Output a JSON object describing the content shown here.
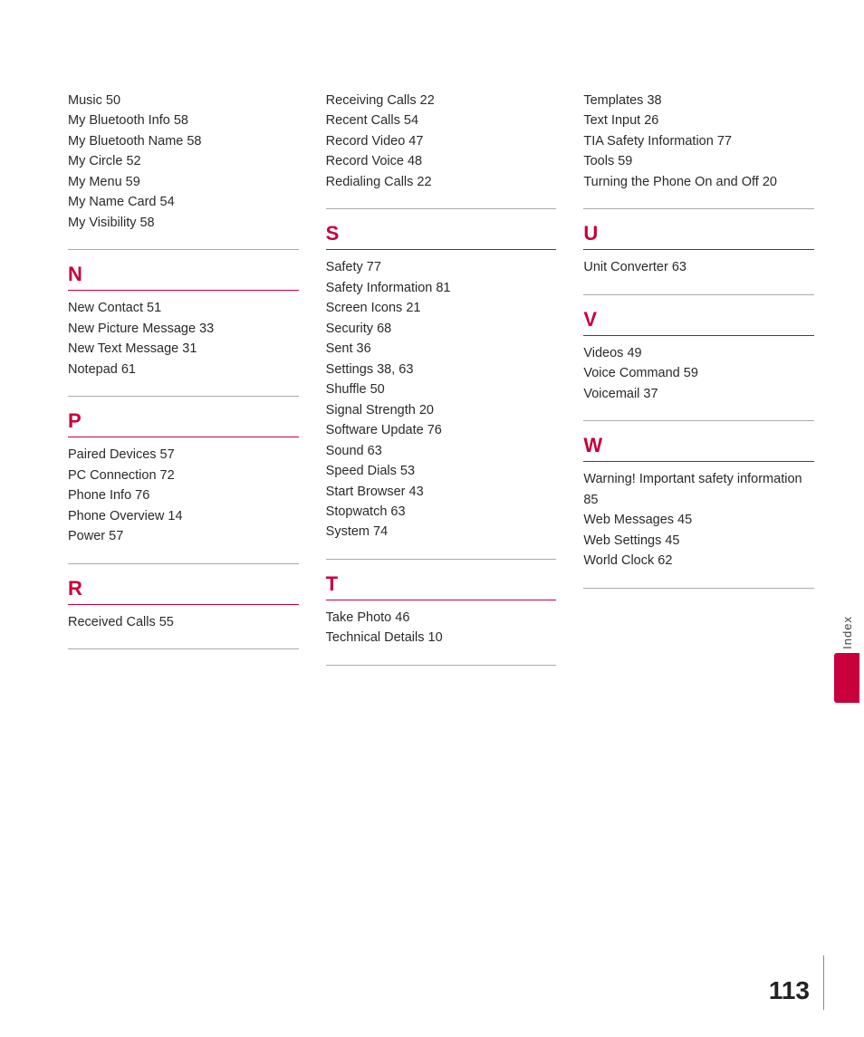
{
  "columns": [
    {
      "id": "col1",
      "sections": [
        {
          "type": "plain",
          "entries": [
            "Music 50",
            "My Bluetooth Info 58",
            "My Bluetooth Name 58",
            "My Circle 52",
            "My Menu 59",
            "My Name Card 54",
            "My Visibility 58"
          ]
        },
        {
          "type": "lettered",
          "letter": "N",
          "entries": [
            "New Contact 51",
            "New Picture Message 33",
            "New Text Message 31",
            "Notepad 61"
          ]
        },
        {
          "type": "lettered",
          "letter": "P",
          "entries": [
            "Paired Devices 57",
            "PC Connection 72",
            "Phone Info 76",
            "Phone Overview 14",
            "Power 57"
          ]
        },
        {
          "type": "lettered",
          "letter": "R",
          "entries": [
            "Received Calls 55"
          ]
        }
      ]
    },
    {
      "id": "col2",
      "sections": [
        {
          "type": "plain",
          "entries": [
            "Receiving Calls 22",
            "Recent Calls 54",
            "Record Video 47",
            "Record Voice 48",
            "Redialing Calls 22"
          ]
        },
        {
          "type": "lettered",
          "letter": "S",
          "entries": [
            "Safety 77",
            "Safety Information 81",
            "Screen Icons 21",
            "Security 68",
            "Sent 36",
            "Settings 38, 63",
            "Shuffle 50",
            "Signal Strength 20",
            "Software Update 76",
            "Sound 63",
            "Speed Dials 53",
            "Start Browser 43",
            "Stopwatch 63",
            "System 74"
          ]
        },
        {
          "type": "lettered",
          "letter": "T",
          "entries": [
            "Take Photo 46",
            "Technical Details 10"
          ]
        }
      ]
    },
    {
      "id": "col3",
      "sections": [
        {
          "type": "plain",
          "entries": [
            "Templates 38",
            "Text Input 26",
            "TIA Safety Information 77",
            "Tools 59",
            "Turning the Phone On and Off 20"
          ]
        },
        {
          "type": "lettered",
          "letter": "U",
          "entries": [
            "Unit Converter 63"
          ]
        },
        {
          "type": "lettered",
          "letter": "V",
          "entries": [
            "Videos 49",
            "Voice Command 59",
            "Voicemail 37"
          ]
        },
        {
          "type": "lettered",
          "letter": "W",
          "entries": [
            "Warning! Important safety information 85",
            "Web Messages 45",
            "Web Settings 45",
            "World Clock 62"
          ]
        }
      ]
    }
  ],
  "page_number": "113",
  "index_label": "Index"
}
